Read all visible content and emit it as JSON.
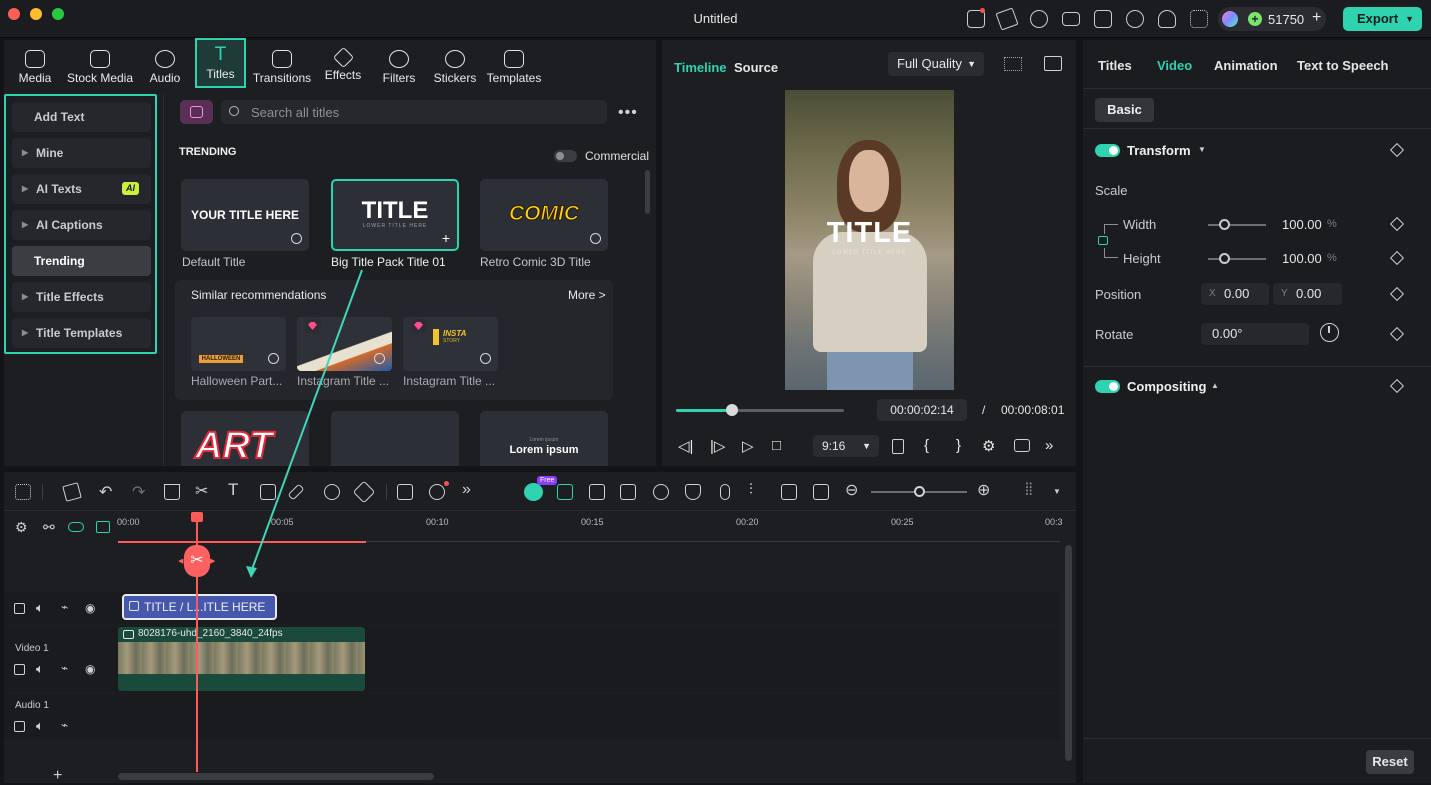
{
  "window": {
    "title": "Untitled"
  },
  "topbar": {
    "credits": "51750",
    "export_label": "Export"
  },
  "library": {
    "tabs": [
      {
        "id": "media",
        "label": "Media"
      },
      {
        "id": "stock",
        "label": "Stock Media"
      },
      {
        "id": "audio",
        "label": "Audio"
      },
      {
        "id": "titles",
        "label": "Titles"
      },
      {
        "id": "transitions",
        "label": "Transitions"
      },
      {
        "id": "effects",
        "label": "Effects"
      },
      {
        "id": "filters",
        "label": "Filters"
      },
      {
        "id": "stickers",
        "label": "Stickers"
      },
      {
        "id": "templates",
        "label": "Templates"
      }
    ],
    "sidebar": [
      {
        "label": "Add Text"
      },
      {
        "label": "Mine"
      },
      {
        "label": "AI Texts",
        "badge": "AI"
      },
      {
        "label": "AI Captions"
      },
      {
        "label": "Trending"
      },
      {
        "label": "Title Effects"
      },
      {
        "label": "Title Templates"
      }
    ],
    "search_placeholder": "Search all titles",
    "section_title": "TRENDING",
    "commercial_label": "Commercial",
    "cards": [
      {
        "thumb": "YOUR TITLE HERE",
        "label": "Default Title"
      },
      {
        "thumb": "TITLE",
        "thumb_sub": "LOWER TITLE HERE",
        "label": "Big Title Pack Title 01"
      },
      {
        "thumb": "COMIC",
        "label": "Retro Comic 3D Title"
      }
    ],
    "similar": {
      "title": "Similar recommendations",
      "more": "More >",
      "items": [
        {
          "thumb": "HALLOWEEN",
          "label": "Halloween Part..."
        },
        {
          "thumb": "",
          "label": "Instagram Title ..."
        },
        {
          "thumb": "INSTA",
          "thumb_sub": "STORY",
          "label": "Instagram Title ..."
        }
      ]
    },
    "bottom_cards": [
      {
        "thumb": "ART"
      },
      {
        "thumb": ""
      },
      {
        "thumb": "Lorem ipsum",
        "thumb_sub": "Lorem ipsum"
      }
    ]
  },
  "preview": {
    "tabs": {
      "timeline": "Timeline",
      "source": "Source"
    },
    "quality": "Full Quality",
    "video_title": "TITLE",
    "video_subtitle": "LOWER TITLE HERE",
    "current_time": "00:00:02:14",
    "separator": "/",
    "duration": "00:00:08:01",
    "aspect": "9:16",
    "progress": 0.33
  },
  "props": {
    "tabs": [
      {
        "label": "Titles"
      },
      {
        "label": "Video"
      },
      {
        "label": "Animation"
      },
      {
        "label": "Text to Speech"
      }
    ],
    "basic": "Basic",
    "transform": "Transform",
    "scale": "Scale",
    "width_label": "Width",
    "width_value": "100.00",
    "height_label": "Height",
    "height_value": "100.00",
    "unit": "%",
    "position": "Position",
    "pos_x_label": "X",
    "pos_x": "0.00",
    "pos_y_label": "Y",
    "pos_y": "0.00",
    "rotate": "Rotate",
    "rotate_value": "0.00°",
    "compositing": "Compositing",
    "reset": "Reset"
  },
  "timeline": {
    "ruler": [
      "00:00",
      "00:05",
      "00:10",
      "00:15",
      "00:20",
      "00:25",
      "00:3"
    ],
    "tracks": {
      "video": "Video 1",
      "audio": "Audio 1"
    },
    "title_clip": "TITLE / L...ITLE HERE",
    "video_clip": "8028176-uhd_2160_3840_24fps",
    "free_badge": "Free",
    "add": "+"
  },
  "colors": {
    "accent": "#2fd3b0",
    "playhead": "#ff5a5a",
    "title_clip": "#4658ad",
    "video_clip": "#1a4a3c"
  }
}
